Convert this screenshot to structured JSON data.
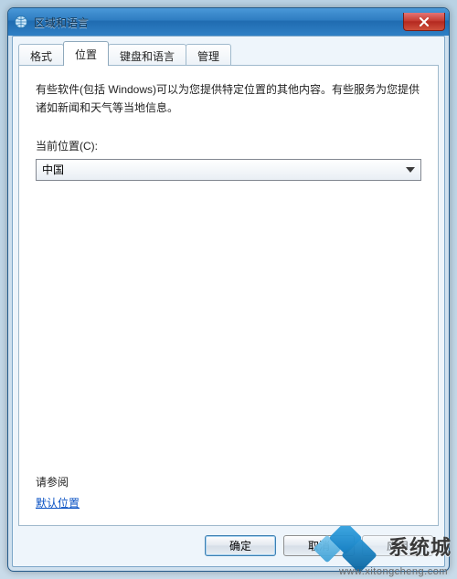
{
  "window": {
    "title": "区域和语言"
  },
  "tabs": [
    {
      "label": "格式",
      "active": false
    },
    {
      "label": "位置",
      "active": true
    },
    {
      "label": "键盘和语言",
      "active": false
    },
    {
      "label": "管理",
      "active": false
    }
  ],
  "content": {
    "description": "有些软件(包括 Windows)可以为您提供特定位置的其他内容。有些服务为您提供诸如新闻和天气等当地信息。",
    "current_location_label": "当前位置(C):",
    "current_location_value": "中国",
    "see_also": "请参阅",
    "default_location_link": "默认位置"
  },
  "buttons": {
    "ok": "确定",
    "cancel": "取消",
    "apply": "应用"
  },
  "watermark": {
    "text": "系统城",
    "url": "www.xitongcheng.com"
  }
}
